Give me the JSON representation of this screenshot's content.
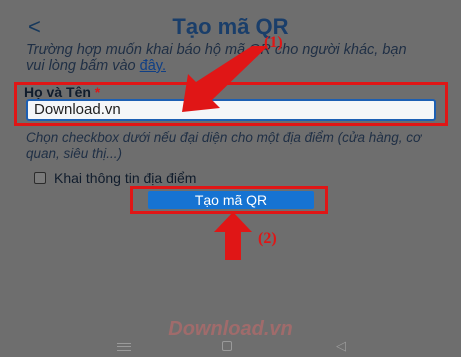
{
  "header": {
    "back_icon": "<",
    "title": "Tạo mã QR"
  },
  "intro": {
    "text": "Trường hợp muốn khai báo hộ mã QR cho người khác, bạn vui lòng bấm vào",
    "link": "đây."
  },
  "form": {
    "name_label": "Họ và Tên",
    "required_mark": "*",
    "name_value": "Download.vn",
    "checkbox_description": "Chọn checkbox dưới nếu đại diện cho một địa điểm (cửa hàng, cơ quan, siêu thị...)",
    "checkbox_label": "Khai thông tin địa điểm",
    "checkbox_checked": false,
    "submit_label": "Tạo mã QR"
  },
  "annotations": {
    "step1": "(1)",
    "step2": "(2)",
    "color": "#e01616"
  },
  "watermark": "Download.vn",
  "navbar": {
    "icons": [
      "menu-icon",
      "home-icon",
      "back-icon"
    ],
    "back_glyph": "◁"
  }
}
